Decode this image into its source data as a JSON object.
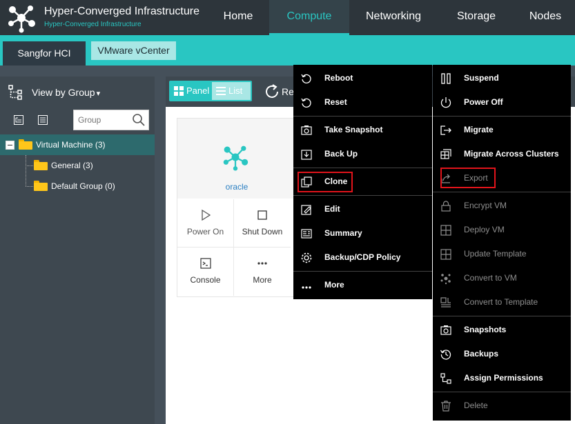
{
  "header": {
    "title": "Hyper-Converged Infrastructure",
    "subtitle": "Hyper-Converged Infrastructure",
    "nav": [
      {
        "label": "Home"
      },
      {
        "label": "Compute"
      },
      {
        "label": "Networking"
      },
      {
        "label": "Storage"
      },
      {
        "label": "Nodes"
      }
    ],
    "active_nav": "Compute"
  },
  "tabs": [
    {
      "label": "Sangfor HCI"
    },
    {
      "label": "VMware vCenter"
    }
  ],
  "sidebar": {
    "view_by_label": "View by Group",
    "view_by_chevron": "▾",
    "search_placeholder": "Group",
    "tree": [
      {
        "label": "Virtual Machine (3)"
      },
      {
        "label": "General (3)"
      },
      {
        "label": "Default Group (0)"
      }
    ]
  },
  "toolbar": {
    "panel_label": "Panel",
    "list_label": "List",
    "refresh_label": "Re"
  },
  "vm_card": {
    "name": "oracle",
    "actions": [
      {
        "label": "Power On",
        "icon": "play-icon"
      },
      {
        "label": "Shut Down",
        "icon": "stop-icon"
      },
      {
        "label": "Console",
        "icon": "console-icon"
      },
      {
        "label": "More",
        "icon": "more-icon"
      }
    ]
  },
  "menu_left": {
    "items": [
      {
        "label": "Reboot",
        "icon": "reboot-icon"
      },
      {
        "label": "Reset",
        "icon": "reset-icon"
      },
      {
        "label": "Take Snapshot",
        "icon": "camera-icon"
      },
      {
        "label": "Back Up",
        "icon": "backup-icon"
      },
      {
        "label": "Clone",
        "icon": "clone-icon"
      },
      {
        "label": "Edit",
        "icon": "edit-icon"
      },
      {
        "label": "Summary",
        "icon": "summary-icon"
      },
      {
        "label": "Backup/CDP Policy",
        "icon": "gear-icon"
      },
      {
        "label": "More",
        "icon": "more-icon"
      }
    ]
  },
  "menu_right": {
    "items": [
      {
        "label": "Suspend",
        "icon": "pause-icon",
        "disabled": false
      },
      {
        "label": "Power Off",
        "icon": "power-icon",
        "disabled": false
      },
      {
        "label": "Migrate",
        "icon": "migrate-icon",
        "disabled": false
      },
      {
        "label": "Migrate Across Clusters",
        "icon": "migrate-clusters-icon",
        "disabled": false
      },
      {
        "label": "Export",
        "icon": "export-icon",
        "disabled": true
      },
      {
        "label": "Encrypt VM",
        "icon": "lock-icon",
        "disabled": true
      },
      {
        "label": "Deploy VM",
        "icon": "grid-icon",
        "disabled": true
      },
      {
        "label": "Update Template",
        "icon": "grid-icon",
        "disabled": true
      },
      {
        "label": "Convert to VM",
        "icon": "convert-icon",
        "disabled": true
      },
      {
        "label": "Convert to Template",
        "icon": "template-icon",
        "disabled": true
      },
      {
        "label": "Snapshots",
        "icon": "camera-icon",
        "disabled": false
      },
      {
        "label": "Backups",
        "icon": "history-icon",
        "disabled": false
      },
      {
        "label": "Assign Permissions",
        "icon": "permissions-icon",
        "disabled": false
      },
      {
        "label": "Delete",
        "icon": "trash-icon",
        "disabled": true
      }
    ]
  },
  "colors": {
    "accent": "#29c6c2",
    "topbar": "#2d353b",
    "highlight": "#e2141b"
  }
}
